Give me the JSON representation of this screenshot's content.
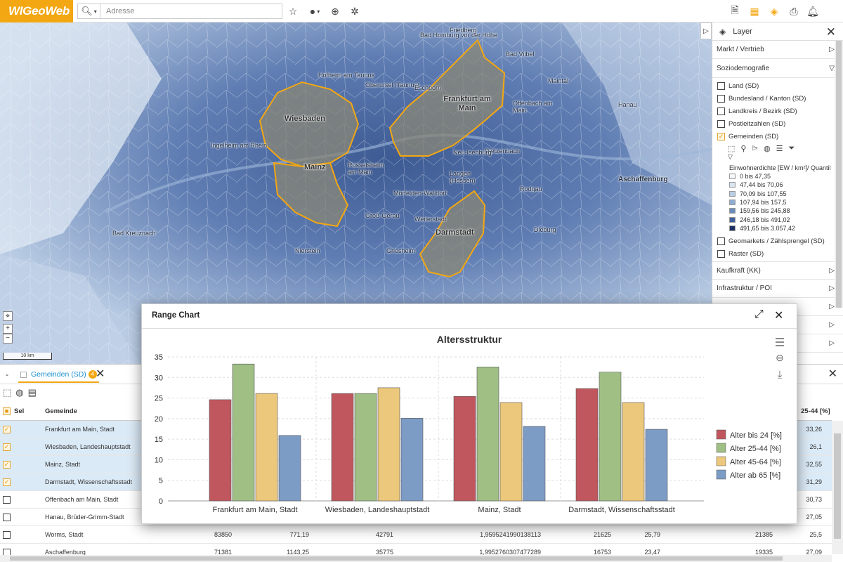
{
  "app": {
    "logo": "WIGeoWeb"
  },
  "toolbar": {
    "search_type_icon": "search-icon",
    "search_placeholder": "Adresse",
    "search_value": "",
    "left_icons": [
      "star-icon",
      "point-dropdown-icon",
      "zoom-search-icon",
      "crosshair-icon"
    ],
    "right_icons": [
      "document-icon",
      "table-icon",
      "layers-icon",
      "print-icon",
      "bell-icon"
    ]
  },
  "map": {
    "scale_label": "10 km",
    "zoom_in": "+",
    "zoom_out": "−",
    "cities": [
      {
        "name": "Wiesbaden"
      },
      {
        "name": "Frankfurt am Main"
      },
      {
        "name": "Mainz"
      },
      {
        "name": "Darmstadt"
      }
    ],
    "labels": [
      "Bad Homburg vor der Höhe",
      "Oberursel (Taunus)",
      "Eschborn",
      "Hofheim am Taunus",
      "Rüsselsheim am Main",
      "Offenbach am Main",
      "Hanau",
      "Dietzenbach",
      "Langen (Hessen)",
      "Neu-Isenburg",
      "Weiterstadt",
      "Groß-Gerau",
      "Ingelheim am Rhein",
      "Bad Kreuznach",
      "Dieburg",
      "Aschaffenburg",
      "Friedberg",
      "Bad Vilbel",
      "Maintal",
      "Rodgau",
      "Mörfelden-Walldorf",
      "Nierstein",
      "Griesheim"
    ]
  },
  "layer_panel": {
    "title": "Layer",
    "groups_top": [
      {
        "label": "Markt / Vertrieb",
        "expanded": false
      },
      {
        "label": "Soziodemografie",
        "expanded": true
      }
    ],
    "layers": [
      {
        "label": "Land (SD)",
        "checked": false
      },
      {
        "label": "Bundesland / Kanton (SD)",
        "checked": false
      },
      {
        "label": "Landkreis / Bezirk (SD)",
        "checked": false
      },
      {
        "label": "Postleitzahlen (SD)",
        "checked": false
      },
      {
        "label": "Gemeinden (SD)",
        "checked": true
      }
    ],
    "layer_tools": [
      "select-area-icon",
      "link-icon",
      "tag-icon",
      "globe-icon",
      "list-icon",
      "filter-icon"
    ],
    "legend_title": "Einwohnerdichte [EW / km²]/ Quantil",
    "legend": [
      {
        "label": "0 bis 47,35",
        "color": "#f4f6fa"
      },
      {
        "label": "47,44 bis 70,06",
        "color": "#d9e4f1"
      },
      {
        "label": "70,09 bis 107,55",
        "color": "#b9cde4"
      },
      {
        "label": "107,94 bis 157,5",
        "color": "#8fadd2"
      },
      {
        "label": "159,56 bis 245,88",
        "color": "#6a8cbd"
      },
      {
        "label": "246,18 bis 491,02",
        "color": "#3f5f99"
      },
      {
        "label": "491,65 bis 3.057,42",
        "color": "#1b2f66"
      }
    ],
    "layers_after": [
      {
        "label": "Geomarkets / Zählsprengel (SD)",
        "checked": false
      },
      {
        "label": "Raster (SD)",
        "checked": false
      }
    ],
    "groups_bottom": [
      {
        "label": "Kaufkraft (KK)",
        "expanded": false
      },
      {
        "label": "Infrastruktur / POI",
        "expanded": false
      }
    ]
  },
  "table_panel": {
    "tab_label": "Gemeinden (SD)",
    "tab_badge": "4",
    "tools": [
      "select-area-icon",
      "globe-icon",
      "calculator-icon"
    ],
    "columns": [
      "Sel",
      "Gemeinde",
      "",
      "",
      "",
      "",
      "",
      "",
      "",
      "25-44 [%]"
    ],
    "rows": [
      {
        "selected": true,
        "gemeinde": "Frankfurt am Main, Stadt",
        "cells": [
          "",
          "",
          "",
          "",
          "",
          "",
          "",
          "33,26"
        ]
      },
      {
        "selected": true,
        "gemeinde": "Wiesbaden, Landeshauptstadt",
        "cells": [
          "",
          "",
          "",
          "",
          "",
          "",
          "",
          "26,1"
        ]
      },
      {
        "selected": true,
        "gemeinde": "Mainz, Stadt",
        "cells": [
          "",
          "",
          "",
          "",
          "",
          "",
          "",
          "32,55"
        ]
      },
      {
        "selected": true,
        "gemeinde": "Darmstadt, Wissenschaftsstadt",
        "cells": [
          "",
          "",
          "",
          "",
          "",
          "",
          "",
          "31,29"
        ]
      },
      {
        "selected": false,
        "gemeinde": "Offenbach am Main, Stadt",
        "cells": [
          "",
          "",
          "",
          "",
          "",
          "",
          "",
          "30,73"
        ]
      },
      {
        "selected": false,
        "gemeinde": "Hanau, Brüder-Grimm-Stadt",
        "cells": [
          "",
          "",
          "",
          "",
          "",
          "",
          "",
          "27,05"
        ]
      },
      {
        "selected": false,
        "gemeinde": "Worms, Stadt",
        "cells": [
          "83850",
          "771,19",
          "42791",
          "1,9595241990138113",
          "21625",
          "25,79",
          "21385",
          "25,5"
        ]
      },
      {
        "selected": false,
        "gemeinde": "Aschaffenburg",
        "cells": [
          "71381",
          "1143,25",
          "35775",
          "1,9952760307477289",
          "16753",
          "23,47",
          "19335",
          "27,09"
        ]
      }
    ]
  },
  "chart_dialog": {
    "title": "Range Chart",
    "menu_icons": [
      "hamburger-menu-icon",
      "link-icon",
      "download-icon"
    ]
  },
  "chart_data": {
    "type": "bar",
    "title": "Altersstruktur",
    "xlabel": "",
    "ylabel": "",
    "ylim": [
      0,
      35
    ],
    "yticks": [
      0,
      5,
      10,
      15,
      20,
      25,
      30,
      35
    ],
    "grid": true,
    "legend_position": "right",
    "categories": [
      "Frankfurt am Main, Stadt",
      "Wiesbaden, Landeshauptstadt",
      "Mainz, Stadt",
      "Darmstadt, Wissenschaftsstadt"
    ],
    "series": [
      {
        "name": "Alter bis 24 [%]",
        "color": "#c0575e",
        "values": [
          24.6,
          26.1,
          25.4,
          27.3
        ]
      },
      {
        "name": "Alter 25-44 [%]",
        "color": "#9fbf85",
        "values": [
          33.26,
          26.1,
          32.55,
          31.29
        ]
      },
      {
        "name": "Alter 45-64 [%]",
        "color": "#ecc87c",
        "values": [
          26.1,
          27.5,
          23.9,
          23.9
        ]
      },
      {
        "name": "Alter ab 65 [%]",
        "color": "#7c9cc5",
        "values": [
          15.9,
          20.1,
          18.1,
          17.4
        ]
      }
    ]
  }
}
